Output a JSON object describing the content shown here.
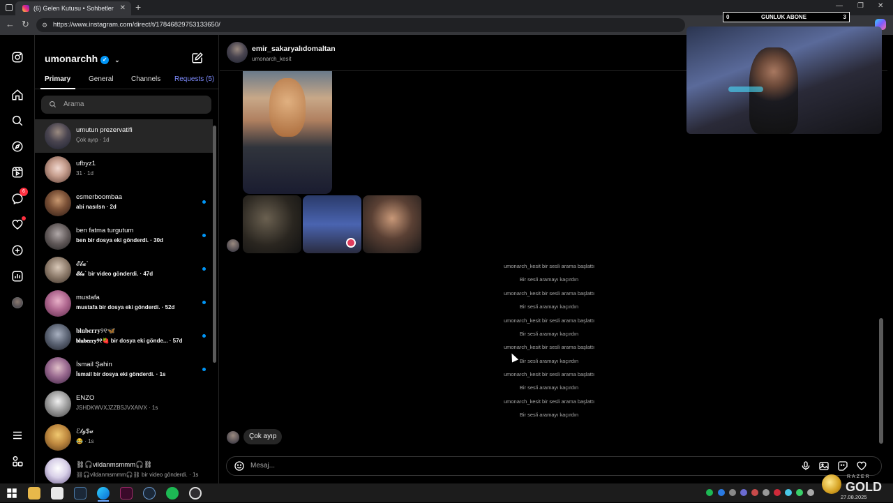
{
  "browser": {
    "tab_title": "(6) Gelen Kutusu • Sohbetler",
    "url": "https://www.instagram.com/direct/t/17846829753133650/"
  },
  "rail": {
    "messages_badge": "6"
  },
  "inbox": {
    "username": "umonarchh",
    "tabs": {
      "primary": "Primary",
      "general": "General",
      "channels": "Channels",
      "requests": "Requests (5)"
    },
    "search_placeholder": "Arama",
    "conversations": [
      {
        "name": "umutun prezervatifi",
        "preview": "Çok ayıp · 1d",
        "unread": false
      },
      {
        "name": "ufbyz1",
        "preview": "31 · 1d",
        "unread": false
      },
      {
        "name": "esmerboombaa",
        "preview": "abi nasılsn · 2d",
        "unread": true
      },
      {
        "name": "ben fatma turgutum",
        "preview": "ben bir dosya eki gönderdi. · 30d",
        "unread": true
      },
      {
        "name": "𝓔𝓵𝓪`",
        "preview": "𝓔𝓵𝓪` bir video gönderdi. · 47d",
        "unread": true
      },
      {
        "name": "mustafa",
        "preview": "mustafa bir dosya eki gönderdi. · 52d",
        "unread": true
      },
      {
        "name": "𝐛𝐥𝐮𝐛𝐞𝐫𝐫𝐲୨୧🦋",
        "preview": "𝐛𝐥𝐮𝐛𝐞𝐫𝐫𝐲୨୧🍓 bir dosya eki gönde... · 57d",
        "unread": true
      },
      {
        "name": "İsmail Şahin",
        "preview": "İsmail bir dosya eki gönderdi. · 1s",
        "unread": true
      },
      {
        "name": "ENZO",
        "preview": "JSHDKWVXJZZBSJVXAIVX · 1s",
        "unread": false
      },
      {
        "name": "ℰ𝓉ℊ$𝓊",
        "preview": "😂 · 1s",
        "unread": false
      },
      {
        "name": "⛓🎧vildanmsmmm🎧⛓",
        "preview": "⛓🎧vildanmsmmm🎧⛓ bir video gönderdi. · 1s",
        "unread": false
      }
    ]
  },
  "chat": {
    "title": "emir_sakaryalıdomaltan",
    "subtitle": "umonarch_kesit",
    "system_messages": [
      "umonarch_kesit bir sesli arama başlattı",
      "Bir sesli aramayı kaçırdın",
      "umonarch_kesit bir sesli arama başlattı",
      "Bir sesli aramayı kaçırdın",
      "umonarch_kesit bir sesli arama başlattı",
      "Bir sesli aramayı kaçırdın",
      "umonarch_kesit bir sesli arama başlattı",
      "Bir sesli aramayı kaçırdın",
      "umonarch_kesit bir sesli arama başlattı",
      "Bir sesli aramayı kaçırdın",
      "umonarch_kesit bir sesli arama başlattı",
      "Bir sesli aramayı kaçırdın"
    ],
    "last_message": "Çok ayıp",
    "composer_placeholder": "Mesaj..."
  },
  "overlay": {
    "counter_left": "0",
    "counter_title": "GUNLUK ABONE",
    "counter_right": "3",
    "brand_small": "RAZER",
    "brand_big": "GOLD"
  },
  "taskbar": {
    "date": "27.08.2025"
  }
}
